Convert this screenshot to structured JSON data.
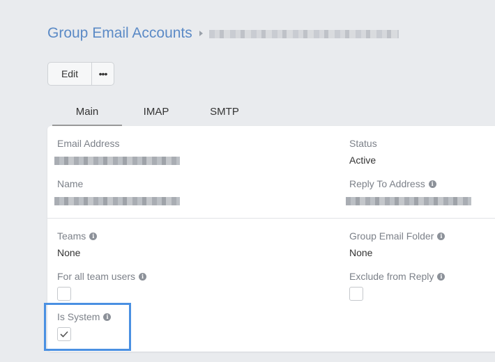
{
  "header": {
    "title": "Group Email Accounts",
    "record_name_redacted": true
  },
  "toolbar": {
    "edit_label": "Edit",
    "more_label": "•••"
  },
  "tabs": [
    {
      "label": "Main"
    },
    {
      "label": "IMAP"
    },
    {
      "label": "SMTP"
    }
  ],
  "fields": {
    "email_address": {
      "label": "Email Address",
      "redacted": true
    },
    "status": {
      "label": "Status",
      "value": "Active"
    },
    "name": {
      "label": "Name",
      "redacted": true
    },
    "reply_to_address": {
      "label": "Reply To Address",
      "redacted": true
    },
    "teams": {
      "label": "Teams",
      "value": "None"
    },
    "group_email_folder": {
      "label": "Group Email Folder",
      "value": "None"
    },
    "for_all_team_users": {
      "label": "For all team users",
      "checked": false
    },
    "exclude_from_reply": {
      "label": "Exclude from Reply",
      "checked": false
    },
    "is_system": {
      "label": "Is System",
      "checked": true
    }
  },
  "icons": {
    "info": "info-icon",
    "check": "checkmark-icon"
  },
  "colors": {
    "title": "#5b8ac6",
    "highlight": "#4a90e2",
    "background": "#e9ebee"
  }
}
